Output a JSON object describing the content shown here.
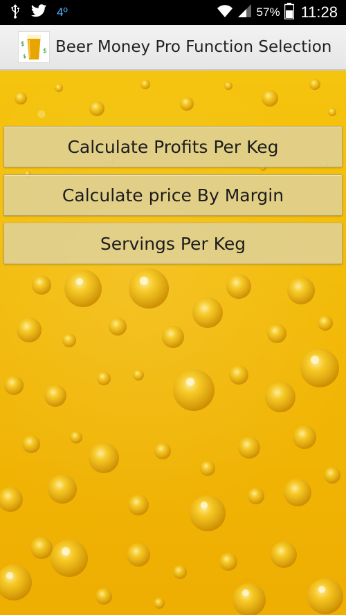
{
  "status_bar": {
    "icons": [
      "usb-icon",
      "twitter-icon"
    ],
    "temperature": "4º",
    "battery_percent": "57%",
    "time": "11:28"
  },
  "action_bar": {
    "app_icon": "beer-glass-icon",
    "title": "Beer Money Pro Function Selection"
  },
  "menu": {
    "buttons": [
      {
        "label": "Calculate Profits Per Keg"
      },
      {
        "label": "Calculate price By Margin"
      },
      {
        "label": "Servings Per Keg"
      }
    ]
  },
  "colors": {
    "beer": "#f2b905",
    "button_bg": "#ded2a0",
    "action_bar": "#eeeeee"
  }
}
